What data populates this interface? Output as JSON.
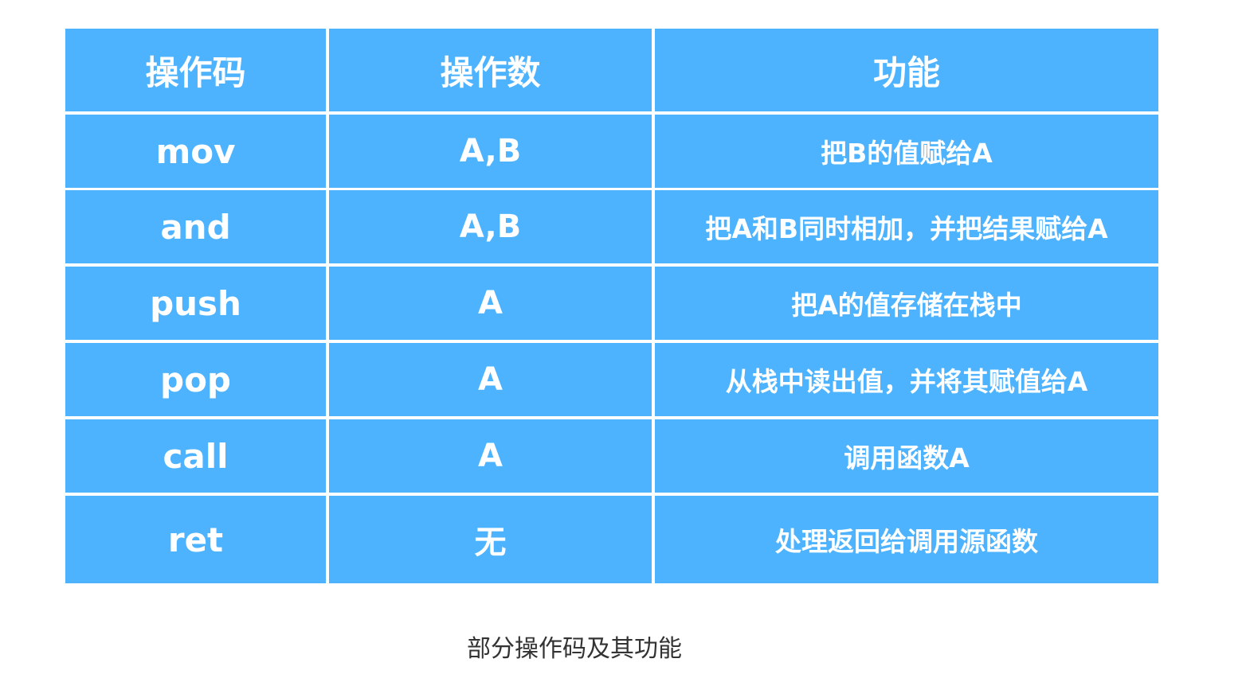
{
  "table": {
    "headers": [
      "操作码",
      "操作数",
      "功能"
    ],
    "rows": [
      [
        "mov",
        "A,B",
        "把B的值赋给A"
      ],
      [
        "and",
        "A,B",
        "把A和B同时相加，并把结果赋给A"
      ],
      [
        "push",
        "A",
        "把A的值存储在栈中"
      ],
      [
        "pop",
        "A",
        "从栈中读出值，并将其赋值给A"
      ],
      [
        "call",
        "A",
        "调用函数A"
      ],
      [
        "ret",
        "无",
        "处理返回给调用源函数"
      ]
    ]
  },
  "caption": "部分操作码及其功能",
  "colors": {
    "cell_bg": "#4db3ff",
    "cell_text": "#ffffff",
    "grid_lines": "#ffffff",
    "caption_text": "#333333"
  }
}
